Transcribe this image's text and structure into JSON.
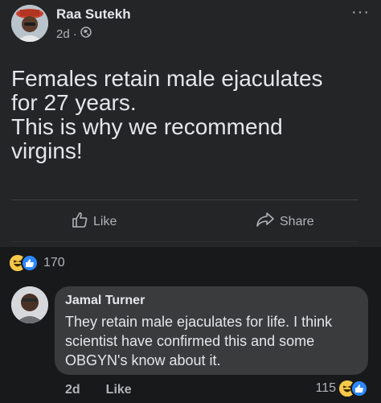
{
  "post": {
    "author": "Raa Sutekh",
    "time": "2d",
    "dot": "·",
    "audience_icon": "globe-icon",
    "more_label": "···",
    "text_lines": [
      "Females retain male ejaculates",
      "for 27 years.",
      "This is why we recommend",
      "virgins!"
    ],
    "like_label": "Like",
    "share_label": "Share",
    "reaction_count": "170"
  },
  "comment": {
    "author": "Jamal Turner",
    "text": "They retain male ejaculates for life. I think scientist have confirmed this and some OBGYN's know about it.",
    "time": "2d",
    "like_label": "Like",
    "reaction_count": "115"
  },
  "colors": {
    "background": "#18191a",
    "card": "#242526",
    "bubble": "#3a3b3c",
    "primary_text": "#e4e6eb",
    "secondary_text": "#b0b3b8",
    "like_blue": "#2d88ff",
    "haha_yellow": "#f7c94b"
  }
}
